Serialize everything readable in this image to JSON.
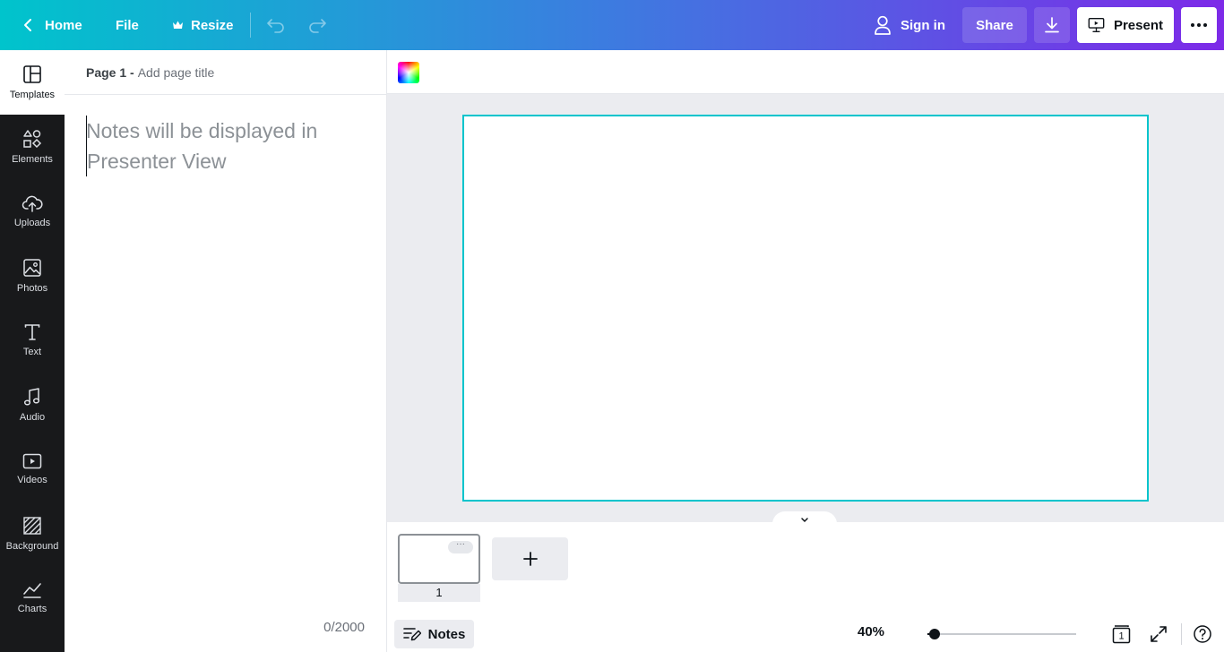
{
  "topbar": {
    "home_label": "Home",
    "file_label": "File",
    "resize_label": "Resize",
    "signin_label": "Sign in",
    "share_label": "Share",
    "present_label": "Present"
  },
  "sidebar": {
    "items": [
      {
        "label": "Templates",
        "icon": "templates-icon"
      },
      {
        "label": "Elements",
        "icon": "elements-icon"
      },
      {
        "label": "Uploads",
        "icon": "uploads-icon"
      },
      {
        "label": "Photos",
        "icon": "photos-icon"
      },
      {
        "label": "Text",
        "icon": "text-icon"
      },
      {
        "label": "Audio",
        "icon": "audio-icon"
      },
      {
        "label": "Videos",
        "icon": "videos-icon"
      },
      {
        "label": "Background",
        "icon": "background-icon"
      },
      {
        "label": "Charts",
        "icon": "charts-icon"
      }
    ]
  },
  "notes_panel": {
    "page_label": "Page 1 -",
    "page_title_placeholder": "Add page title",
    "notes_placeholder": "Notes will be displayed in Presenter View",
    "char_count": "0/2000"
  },
  "pages": {
    "thumbnails": [
      {
        "number": "1"
      }
    ]
  },
  "footer": {
    "notes_label": "Notes",
    "zoom": "40%",
    "zoom_fraction": 0.05,
    "page_count": "1"
  },
  "colors": {
    "accent": "#00c4cc",
    "gradient_start": "#00c4cc",
    "gradient_end": "#7d2ae8",
    "sidebar_bg": "#18191b"
  }
}
